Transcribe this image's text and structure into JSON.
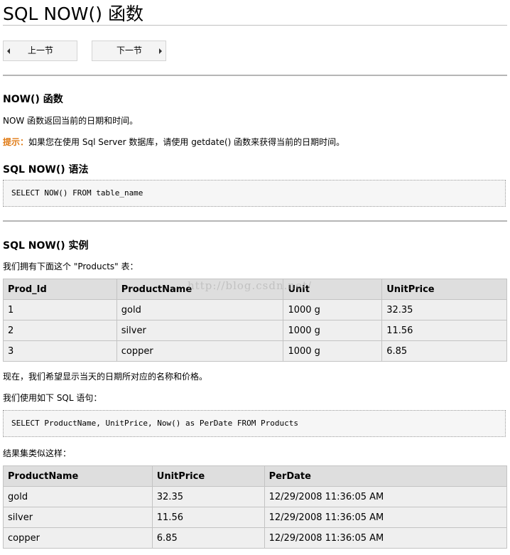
{
  "page_title": "SQL NOW() 函数",
  "nav": {
    "prev_label": "上一节",
    "next_label": "下一节"
  },
  "section1": {
    "heading": "NOW() 函数",
    "desc": "NOW 函数返回当前的日期和时间。",
    "tip_label": "提示：",
    "tip_text": "如果您在使用 Sql Server 数据库，请使用 getdate() 函数来获得当前的日期时间。"
  },
  "syntax": {
    "heading": "SQL NOW() 语法",
    "code": "SELECT NOW() FROM table_name"
  },
  "example": {
    "heading": "SQL NOW() 实例",
    "intro": "我们拥有下面这个 \"Products\" 表：",
    "products_table": {
      "headers": [
        "Prod_Id",
        "ProductName",
        "Unit",
        "UnitPrice"
      ],
      "rows": [
        [
          "1",
          "gold",
          "1000 g",
          "32.35"
        ],
        [
          "2",
          "silver",
          "1000 g",
          "11.56"
        ],
        [
          "3",
          "copper",
          "1000 g",
          "6.85"
        ]
      ]
    },
    "goal_text": "现在，我们希望显示当天的日期所对应的名称和价格。",
    "use_sql_text": "我们使用如下 SQL 语句：",
    "code": "SELECT ProductName, UnitPrice, Now() as PerDate FROM Products",
    "result_text": "结果集类似这样：",
    "result_table": {
      "headers": [
        "ProductName",
        "UnitPrice",
        "PerDate"
      ],
      "rows": [
        [
          "gold",
          "32.35",
          "12/29/2008 11:36:05 AM"
        ],
        [
          "silver",
          "11.56",
          "12/29/2008 11:36:05 AM"
        ],
        [
          "copper",
          "6.85",
          "12/29/2008 11:36:05 AM"
        ]
      ]
    }
  },
  "watermark": "http://blog.csdn.net/"
}
